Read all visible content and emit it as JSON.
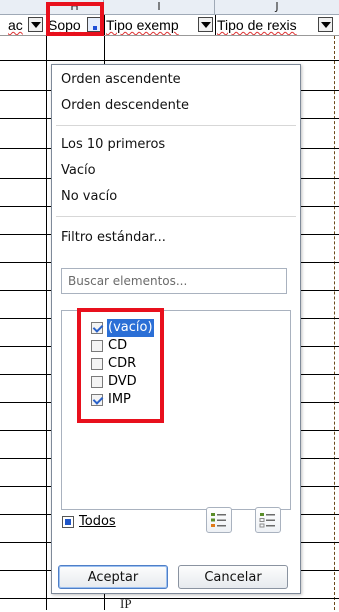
{
  "sheet": {
    "column_letters": [
      "H",
      "I",
      "J"
    ],
    "field_headers": [
      "ac",
      "Sopo",
      "Tipo exemp",
      "Tipo de rexis"
    ],
    "peek_text": "IP"
  },
  "popup": {
    "sort": {
      "ascending": "Orden ascendente",
      "descending": "Orden descendente"
    },
    "filters": {
      "top10": "Los 10 primeros",
      "empty": "Vacío",
      "not_empty": "No vacío"
    },
    "standard_filter": "Filtro estándar...",
    "search": {
      "placeholder": "Buscar elementos..."
    },
    "items": [
      {
        "label": "(vacío)",
        "checked": true,
        "selected": true
      },
      {
        "label": "CD",
        "checked": false,
        "selected": false
      },
      {
        "label": "CDR",
        "checked": false,
        "selected": false
      },
      {
        "label": "DVD",
        "checked": false,
        "selected": false
      },
      {
        "label": "IMP",
        "checked": true,
        "selected": false
      }
    ],
    "all_label": "Todos",
    "select_all_icon": "select-all-icon",
    "select_current_icon": "select-current-icon",
    "accept_label": "Aceptar",
    "cancel_label": "Cancelar"
  },
  "colors": {
    "highlight": "#e8101d",
    "selection": "#2b6fd6",
    "check": "#2a62c9"
  }
}
